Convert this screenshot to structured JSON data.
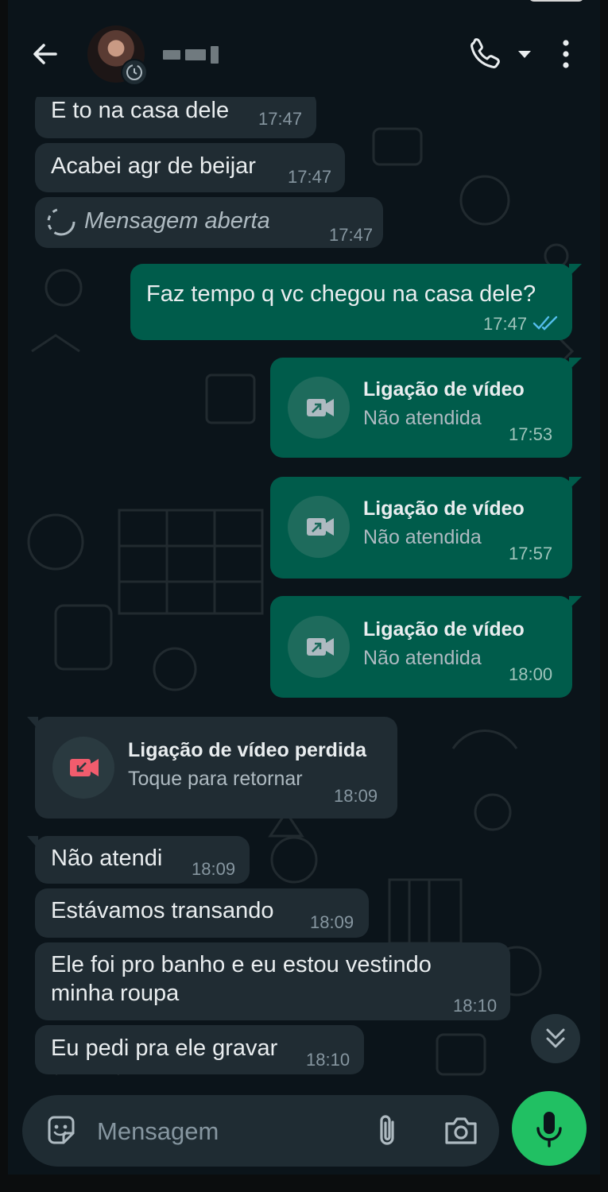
{
  "header": {
    "contact_name": "",
    "icons": [
      "back-arrow-icon",
      "avatar",
      "call-icon",
      "chevron-down-icon",
      "more-vertical-icon"
    ]
  },
  "messages": [
    {
      "dir": "in",
      "text": "E to na casa dele",
      "time": "17:47"
    },
    {
      "dir": "in",
      "text": "Acabei agr de beijar",
      "time": "17:47"
    },
    {
      "dir": "in",
      "type": "view-once",
      "text": "Mensagem aberta",
      "time": "17:47"
    },
    {
      "dir": "out",
      "text": "Faz tempo q vc chegou na casa dele?",
      "time": "17:47",
      "status": "read"
    },
    {
      "dir": "out",
      "type": "call",
      "title": "Ligação de vídeo",
      "subtitle": "Não atendida",
      "time": "17:53"
    },
    {
      "dir": "out",
      "type": "call",
      "title": "Ligação de vídeo",
      "subtitle": "Não atendida",
      "time": "17:57"
    },
    {
      "dir": "out",
      "type": "call",
      "title": "Ligação de vídeo",
      "subtitle": "Não atendida",
      "time": "18:00"
    },
    {
      "dir": "in",
      "type": "missed-call",
      "title": "Ligação de vídeo perdida",
      "subtitle": "Toque para retornar",
      "time": "18:09"
    },
    {
      "dir": "in",
      "text": "Não atendi",
      "time": "18:09"
    },
    {
      "dir": "in",
      "text": "Estávamos transando",
      "time": "18:09"
    },
    {
      "dir": "in",
      "text": "Ele foi pro banho e eu estou vestindo",
      "text2": "minha roupa",
      "time": "18:10"
    },
    {
      "dir": "in",
      "text": "Eu pedi pra ele gravar",
      "time": "18:10"
    }
  ],
  "composer": {
    "placeholder": "Mensagem"
  },
  "colors": {
    "background": "#0b141a",
    "incoming_bubble": "#202c33",
    "outgoing_bubble": "#005c4b",
    "accent_green": "#21c063",
    "missed_red": "#f15c6d",
    "read_tick_blue": "#53bdeb"
  }
}
